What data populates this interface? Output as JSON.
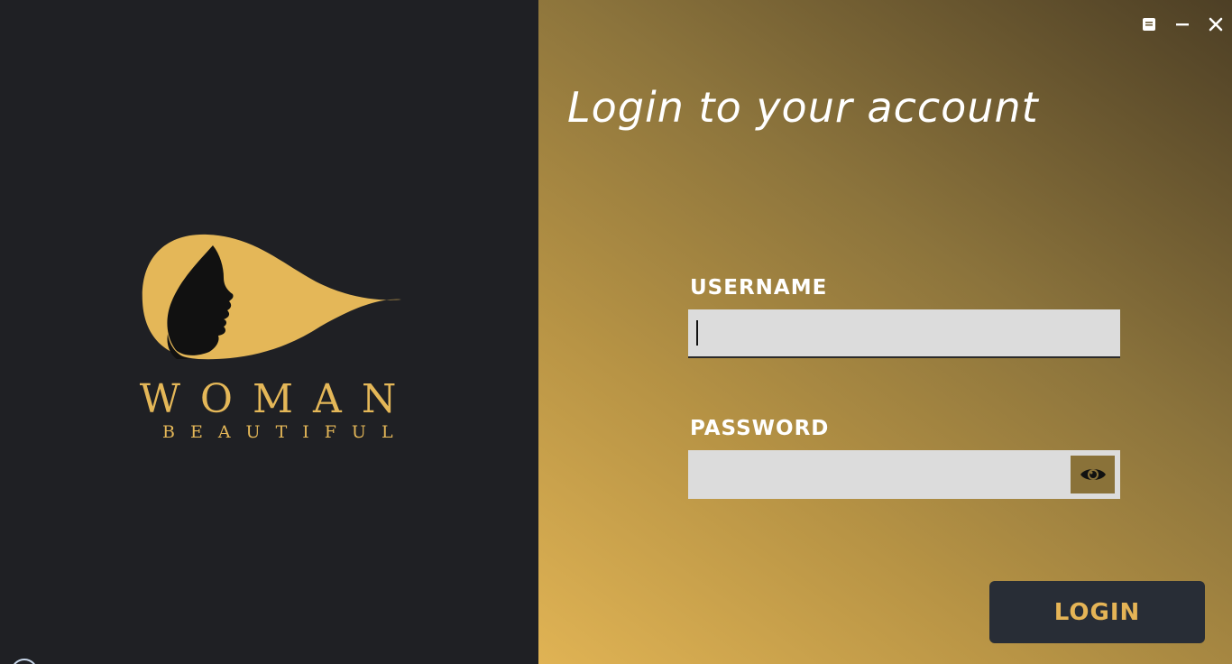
{
  "brand": {
    "name": "WOMAN",
    "tagline": "BEAUTIFUL"
  },
  "window_controls": {
    "icons": [
      "restore-icon",
      "minimize-icon",
      "close-icon"
    ]
  },
  "login_form": {
    "title": "Login to your account",
    "username_label": "USERNAME",
    "username_value": "",
    "password_label": "PASSWORD",
    "password_value": "",
    "show_password_icon": "eye-icon",
    "login_button": "LOGIN"
  },
  "colors": {
    "left_background": "#1f2024",
    "brand_gold": "#e4b758",
    "input_background": "#dcdcdc",
    "button_background": "#282d36",
    "button_text": "#e5b456"
  }
}
